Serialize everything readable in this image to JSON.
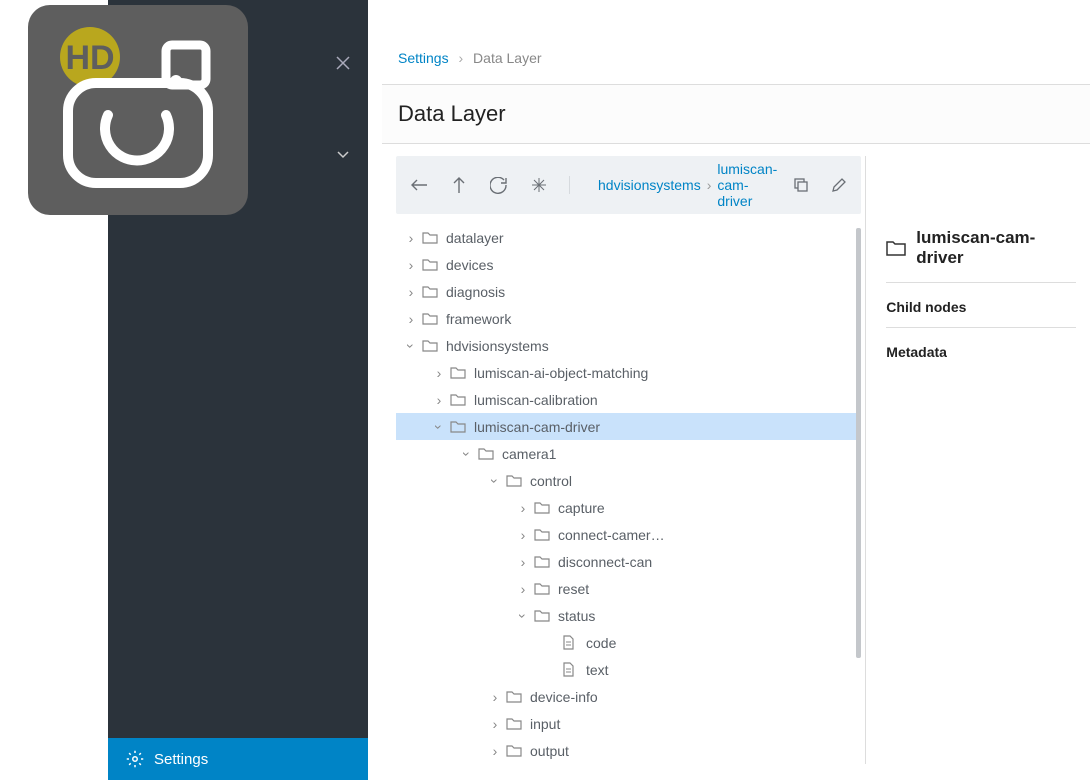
{
  "sidebar": {
    "bottom_label": "Settings"
  },
  "breadcrumb": {
    "root": "Settings",
    "current": "Data Layer"
  },
  "page_title": "Data Layer",
  "toolbar_breadcrumb": {
    "part1": "hdvisionsystems",
    "part2": "lumiscan-cam-driver"
  },
  "tree": {
    "n0": "datalayer",
    "n1": "devices",
    "n2": "diagnosis",
    "n3": "framework",
    "n4": "hdvisionsystems",
    "n5": "lumiscan-ai-object-matching",
    "n6": "lumiscan-calibration",
    "n7": "lumiscan-cam-driver",
    "n8": "camera1",
    "n9": "control",
    "n10": "capture",
    "n11": "connect-camer…",
    "n12": "disconnect-can",
    "n13": "reset",
    "n14": "status",
    "n15": "code",
    "n16": "text",
    "n17": "device-info",
    "n18": "input",
    "n19": "output"
  },
  "detail": {
    "title": "lumiscan-cam-driver",
    "section1": "Child nodes",
    "section2": "Metadata"
  }
}
